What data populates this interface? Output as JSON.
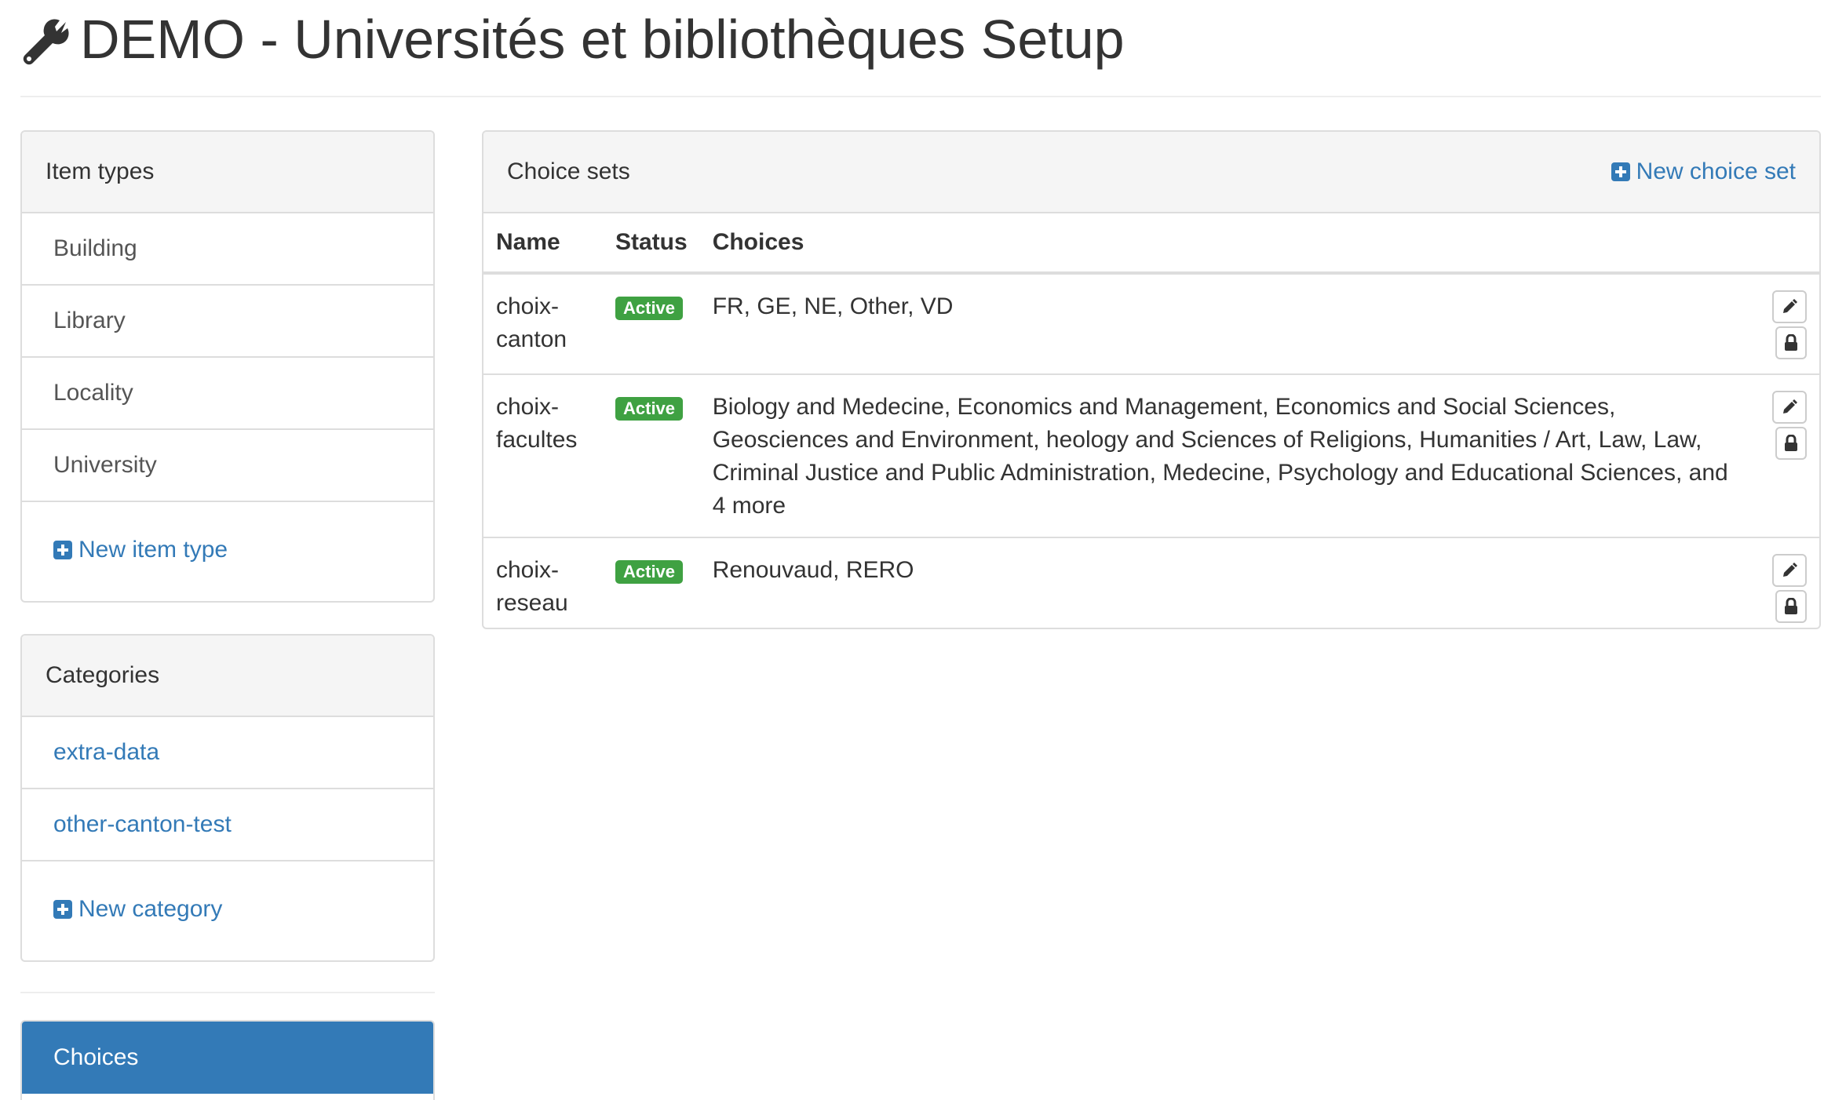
{
  "header": {
    "title": "DEMO - Universités et bibliothèques Setup",
    "icon": "wrench-icon"
  },
  "item_types": {
    "heading": "Item types",
    "items": [
      {
        "label": "Building"
      },
      {
        "label": "Library"
      },
      {
        "label": "Locality"
      },
      {
        "label": "University"
      }
    ],
    "new_label": "New item type"
  },
  "categories": {
    "heading": "Categories",
    "items": [
      {
        "label": "extra-data"
      },
      {
        "label": "other-canton-test"
      }
    ],
    "new_label": "New category"
  },
  "nav": {
    "choices_label": "Choices"
  },
  "choice_sets": {
    "heading": "Choice sets",
    "new_label": "New choice set",
    "columns": [
      "Name",
      "Status",
      "Choices"
    ],
    "rows": [
      {
        "name": "choix-canton",
        "status": "Active",
        "choices": "FR, GE, NE, Other, VD"
      },
      {
        "name": "choix-facultes",
        "status": "Active",
        "choices": "Biology and Medecine, Economics and Management, Economics and Social Sciences, Geosciences and Environment, heology and Sciences of Religions, Humanities / Art, Law, Law, Criminal Justice and Public Administration, Medecine, Psychology and Educational Sciences, and 4 more"
      },
      {
        "name": "choix-reseau",
        "status": "Active",
        "choices": "Renouvaud, RERO"
      }
    ]
  },
  "colors": {
    "link": "#337ab7",
    "active_badge": "#3fa142",
    "heading_bg": "#f5f5f5",
    "border": "#dddddd"
  }
}
